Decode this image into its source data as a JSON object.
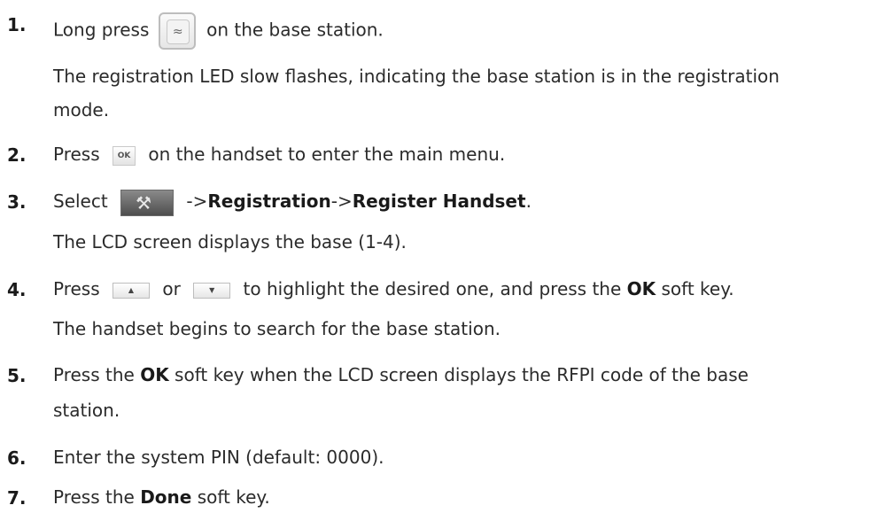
{
  "steps": [
    {
      "num": "1.",
      "before": "Long press",
      "icon": "registration-button-icon",
      "after": "on the base station."
    },
    {
      "line1": "The registration LED slow flashes, indicating the base station is in the registration",
      "line2": "mode."
    },
    {
      "num": "2.",
      "before": "Press",
      "icon": "ok-key-icon",
      "icon_text": "OK",
      "after": "on the handset to enter the main menu."
    },
    {
      "num": "3.",
      "before": "Select",
      "icon": "settings-menu-icon",
      "sep1": "->",
      "b1": "Registration",
      "sep2": "->",
      "b2": "Register Handset",
      "end": "."
    },
    {
      "line": "The LCD screen displays the base (1-4)."
    },
    {
      "num": "4.",
      "before": "Press",
      "icon1": "navigation-up-key-icon",
      "mid": "or",
      "icon2": "navigation-down-key-icon",
      "after": "to highlight the desired one, and press the",
      "bold": "OK",
      "tail": "soft key."
    },
    {
      "line": "The handset begins to search for the base station."
    },
    {
      "num": "5.",
      "before": "Press the",
      "bold": "OK",
      "after": "soft key when the LCD screen displays the RFPI code of the base",
      "line2": "station."
    },
    {
      "num": "6.",
      "text": "Enter the system PIN (default: 0000)."
    },
    {
      "num": "7.",
      "before": "Press the",
      "bold": "Done",
      "after": "soft key."
    }
  ]
}
